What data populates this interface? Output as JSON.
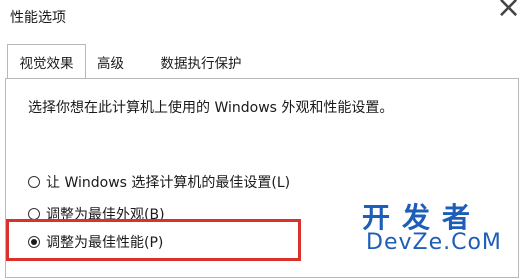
{
  "window": {
    "title": "性能选项"
  },
  "tabs": [
    {
      "label": "视觉效果",
      "active": true
    },
    {
      "label": "高级",
      "active": false
    },
    {
      "label": "数据执行保护",
      "active": false
    }
  ],
  "panel": {
    "description": "选择你想在此计算机上使用的 Windows 外观和性能设置。",
    "options": [
      {
        "label": "让 Windows 选择计算机的最佳设置(L)",
        "checked": false
      },
      {
        "label": "调整为最佳外观(B)",
        "checked": false
      },
      {
        "label": "调整为最佳性能(P)",
        "checked": true
      }
    ]
  },
  "watermark": {
    "line1": "开发者",
    "line2": "DevZe.CoM"
  },
  "colors": {
    "highlight": "#d9312b",
    "watermark": "#1d5fb7"
  }
}
